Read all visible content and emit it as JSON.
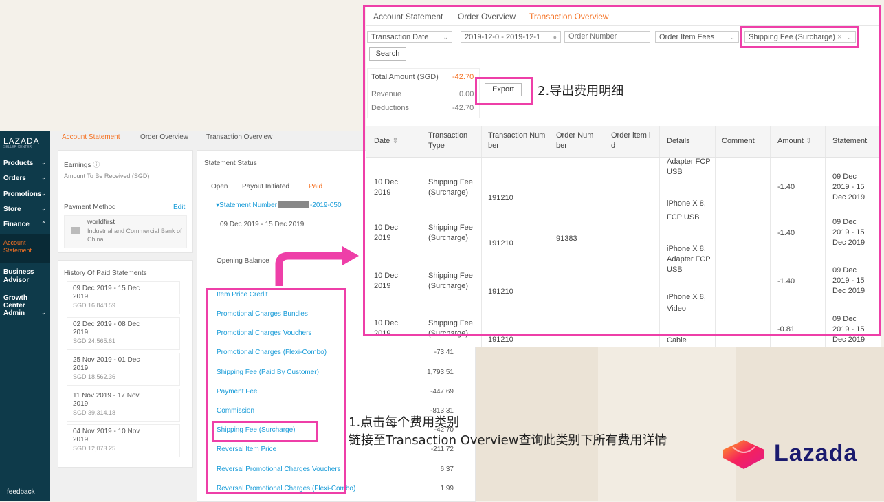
{
  "sidebar": {
    "logo": "LAZADA",
    "logo_sub": "SELLER CENTER",
    "items": [
      "Products",
      "Orders",
      "Promotions",
      "Store",
      "Finance",
      "Business Advisor",
      "Growth Center",
      "Admin"
    ],
    "active_item": "Account Statement",
    "feedback": "feedback"
  },
  "account_statement": {
    "tabs": [
      "Account Statement",
      "Order Overview",
      "Transaction Overview"
    ],
    "earnings_title": "Earnings",
    "amount_to_receive": "Amount To Be Received (SGD)",
    "payment_method": "Payment Method",
    "edit": "Edit",
    "pm_name": "worldfirst",
    "pm_bank": "Industrial and Commercial Bank of China",
    "history_title": "History Of Paid Statements",
    "history": [
      {
        "date": "09 Dec 2019 - 15 Dec 2019",
        "amount": "SGD 16,848.59"
      },
      {
        "date": "02 Dec 2019 - 08 Dec 2019",
        "amount": "SGD 24,565.61"
      },
      {
        "date": "25 Nov 2019 - 01 Dec 2019",
        "amount": "SGD 18,562.36"
      },
      {
        "date": "11 Nov 2019 - 17 Nov 2019",
        "amount": "SGD 39,314.18"
      },
      {
        "date": "04 Nov 2019 - 10 Nov 2019",
        "amount": "SGD 12,073.25"
      }
    ],
    "statement_status": "Statement Status",
    "status_tabs": [
      "Open",
      "Payout Initiated",
      "Paid"
    ],
    "statement_number_label": "Statement Number",
    "statement_number_suffix": "-2019-050",
    "statement_period": "09 Dec 2019 - 15 Dec 2019",
    "opening_balance": "Opening Balance",
    "fees": [
      {
        "name": "Item Price Credit",
        "value": ""
      },
      {
        "name": "Promotional Charges Bundles",
        "value": ""
      },
      {
        "name": "Promotional Charges Vouchers",
        "value": ""
      },
      {
        "name": "Promotional Charges (Flexi-Combo)",
        "value": "-73.41"
      },
      {
        "name": "Shipping Fee (Paid By Customer)",
        "value": "1,793.51"
      },
      {
        "name": "Payment Fee",
        "value": "-447.69"
      },
      {
        "name": "Commission",
        "value": "-813.31"
      },
      {
        "name": "Shipping Fee (Surcharge)",
        "value": "-42.70"
      },
      {
        "name": "Reversal Item Price",
        "value": "-211.72"
      },
      {
        "name": "Reversal Promotional Charges Vouchers",
        "value": "6.37"
      },
      {
        "name": "Reversal Promotional Charges (Flexi-Combo)",
        "value": "1.99"
      }
    ]
  },
  "transaction_overview": {
    "tabs": [
      "Account Statement",
      "Order Overview",
      "Transaction Overview"
    ],
    "filters": {
      "date_type": "Transaction Date",
      "date_range_start": "2019-12-0",
      "date_range_sep": "-",
      "date_range_end": "2019-12-1",
      "order_number_placeholder": "Order Number",
      "fee_group": "Order Item Fees",
      "fee_type": "Shipping Fee (Surcharge)"
    },
    "search": "Search",
    "export": "Export",
    "summary": {
      "total_label": "Total Amount (SGD)",
      "total_value": "-42.70",
      "revenue_label": "Revenue",
      "revenue_value": "0.00",
      "deductions_label": "Deductions",
      "deductions_value": "-42.70"
    },
    "columns": [
      "Date",
      "Transaction Type",
      "Transaction Number",
      "Order Number",
      "Order item id",
      "Details",
      "Comment",
      "Amount",
      "Statement"
    ],
    "rows": [
      {
        "date": "10 Dec 2019",
        "type": "Shipping Fee (Surcharge)",
        "txn": "191210",
        "order": "",
        "details_top": "Adapter FCP USB",
        "details_bottom": "iPhone X 8,",
        "amount": "-1.40",
        "statement": "09 Dec 2019 - 15 Dec 2019"
      },
      {
        "date": "10 Dec 2019",
        "type": "Shipping Fee (Surcharge)",
        "txn": "191210",
        "order": "91383",
        "details_top": "FCP USB",
        "details_bottom": "iPhone X 8,",
        "amount": "-1.40",
        "statement": "09 Dec 2019 - 15 Dec 2019"
      },
      {
        "date": "10 Dec 2019",
        "type": "Shipping Fee (Surcharge)",
        "txn": "191210",
        "order": "",
        "details_top": "Adapter FCP USB",
        "details_bottom": "iPhone X 8,",
        "amount": "-1.40",
        "statement": "09 Dec 2019 - 15 Dec 2019"
      },
      {
        "date": "10 Dec 2019",
        "type": "Shipping Fee (Surcharge)",
        "txn": "191210",
        "order": "",
        "details_top": "Video",
        "details_bottom": "Cable",
        "amount": "-0.81",
        "statement": "09 Dec 2019 - 15 Dec 2019"
      }
    ]
  },
  "annotations": {
    "step1_line1": "1.点击每个费用类别",
    "step1_line2": "链接至Transaction Overview查询此类别下所有费用详情",
    "step2": "2.导出费用明细"
  },
  "brand": {
    "name": "Lazada",
    "accent": "#f57224",
    "highlight": "#ee3fa8",
    "link": "#1a9cd8"
  }
}
